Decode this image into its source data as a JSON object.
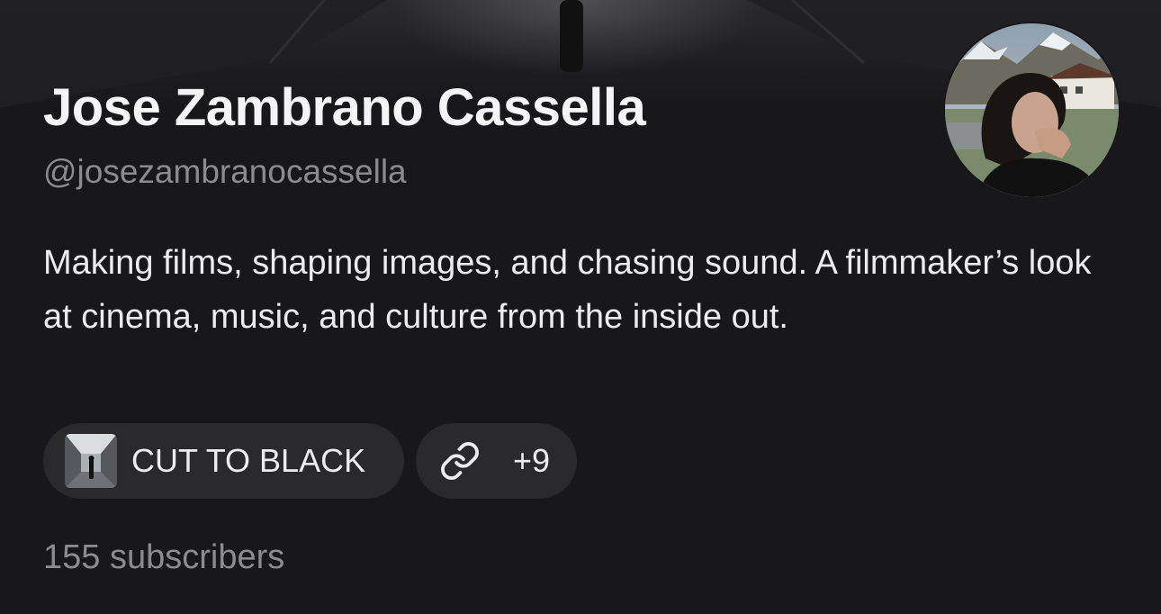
{
  "profile": {
    "name": "Jose Zambrano Cassella",
    "handle": "@josezambranocassella",
    "bio": "Making films, shaping images, and chasing sound. A filmmaker’s look at cinema, music, and culture from the inside out.",
    "subscribers": "155 subscribers"
  },
  "publication": {
    "label": "CUT TO BLACK",
    "thumbnail_icon": "corridor-thumbnail"
  },
  "links": {
    "icon": "link-icon",
    "count": "+9"
  },
  "colors": {
    "background": "#18181a",
    "pill_background": "#2a2a2d",
    "primary_text": "#f4f4f5",
    "secondary_text": "#8b8b90"
  }
}
